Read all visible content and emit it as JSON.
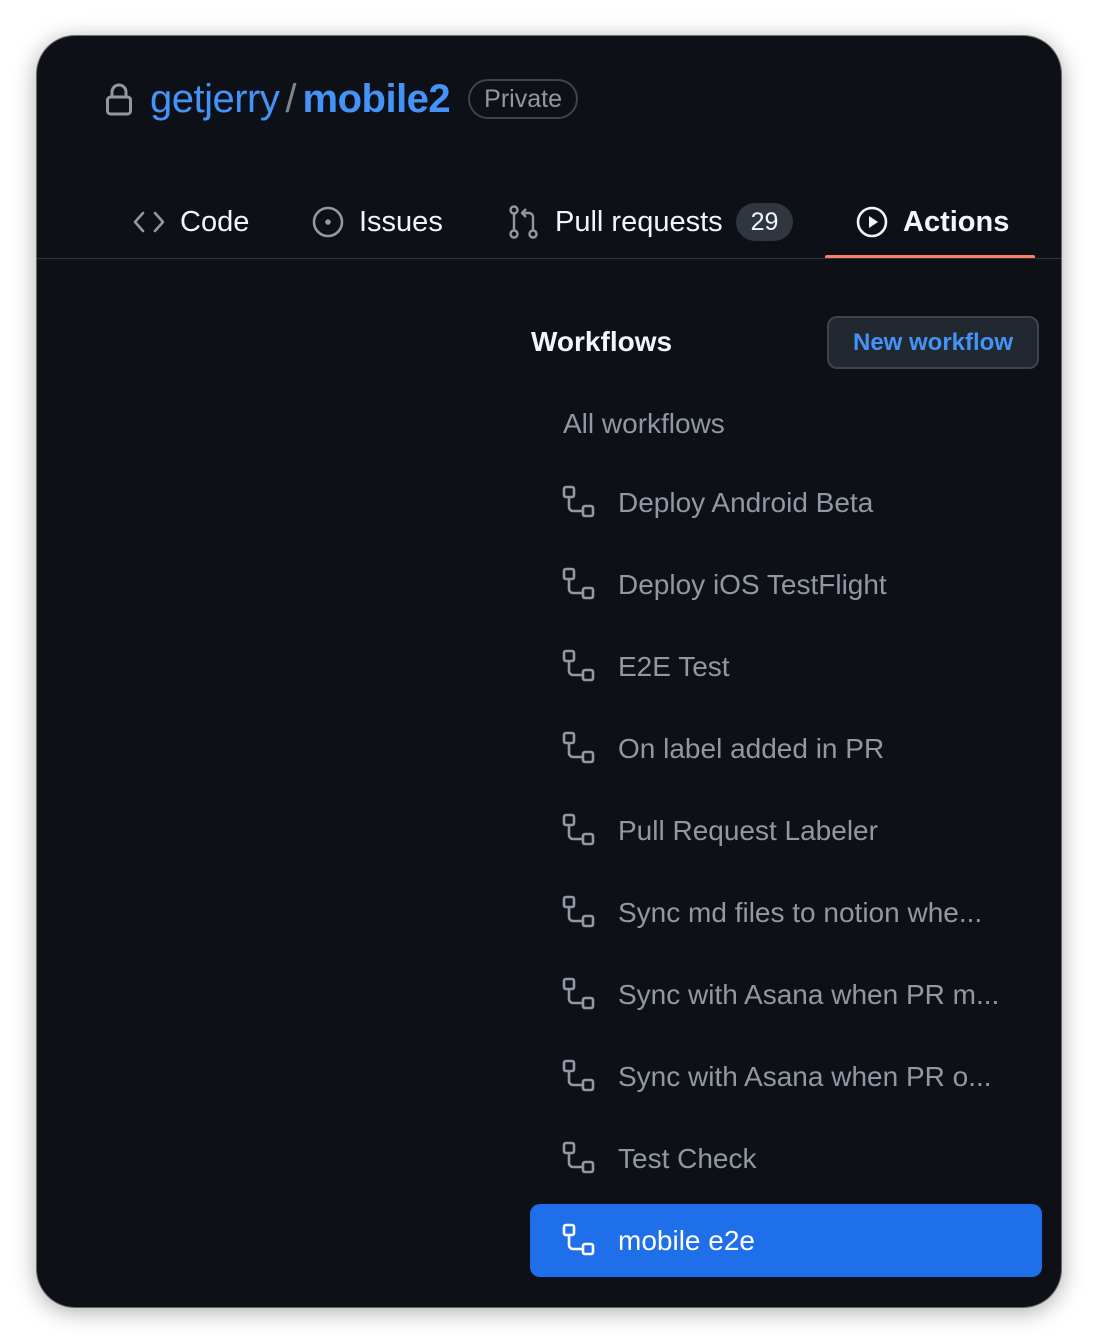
{
  "repo": {
    "owner": "getjerry",
    "separator": "/",
    "name": "mobile2",
    "visibility": "Private"
  },
  "tabs": [
    {
      "label": "Code",
      "icon": "code-icon"
    },
    {
      "label": "Issues",
      "icon": "issue-icon"
    },
    {
      "label": "Pull requests",
      "icon": "pull-request-icon",
      "count": "29"
    },
    {
      "label": "Actions",
      "icon": "play-icon",
      "active": true
    }
  ],
  "workflows": {
    "heading": "Workflows",
    "new_button": "New workflow",
    "all_label": "All workflows",
    "items": [
      {
        "label": "Deploy Android Beta"
      },
      {
        "label": "Deploy iOS TestFlight"
      },
      {
        "label": "E2E Test"
      },
      {
        "label": "On label added in PR"
      },
      {
        "label": "Pull Request Labeler"
      },
      {
        "label": "Sync md files to notion whe..."
      },
      {
        "label": "Sync with Asana when PR m..."
      },
      {
        "label": "Sync with Asana when PR o..."
      },
      {
        "label": "Test Check"
      },
      {
        "label": "mobile e2e",
        "selected": true
      }
    ]
  },
  "colors": {
    "background": "#0d1117",
    "link": "#4493f8",
    "active_tab_underline": "#f78166",
    "selected_item": "#1f6feb"
  }
}
